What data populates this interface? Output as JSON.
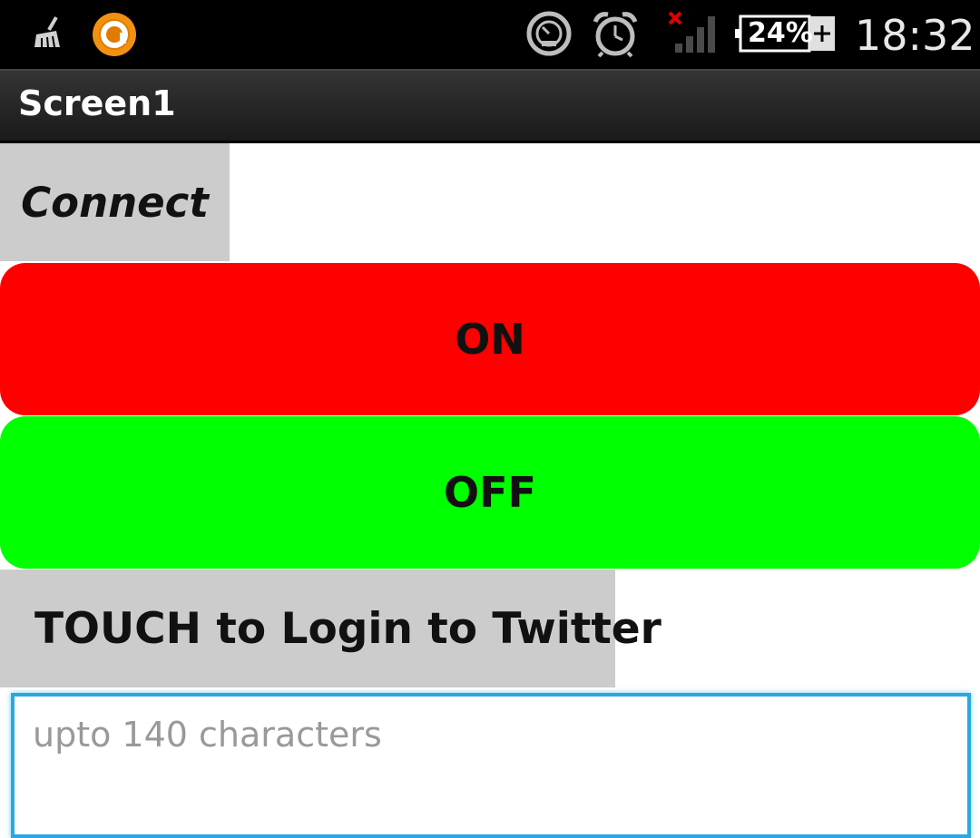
{
  "status_bar": {
    "battery_percent": "24%",
    "time": "18:32",
    "icons": [
      "broom-icon",
      "app-circle-icon",
      "speedometer-icon",
      "alarm-clock-icon",
      "no-signal-icon",
      "battery-charging-icon"
    ]
  },
  "title_bar": {
    "title": "Screen1"
  },
  "buttons": {
    "connect_label": "Connect",
    "on_label": "ON",
    "off_label": "OFF",
    "twitter_label": "TOUCH to Login to Twitter"
  },
  "tweet_input": {
    "placeholder": "upto 140 characters",
    "value": ""
  },
  "colors": {
    "on_button": "#ff0000",
    "off_button": "#00ff00",
    "gray_button": "#cccccc",
    "input_focus_border": "#29a9e0"
  }
}
